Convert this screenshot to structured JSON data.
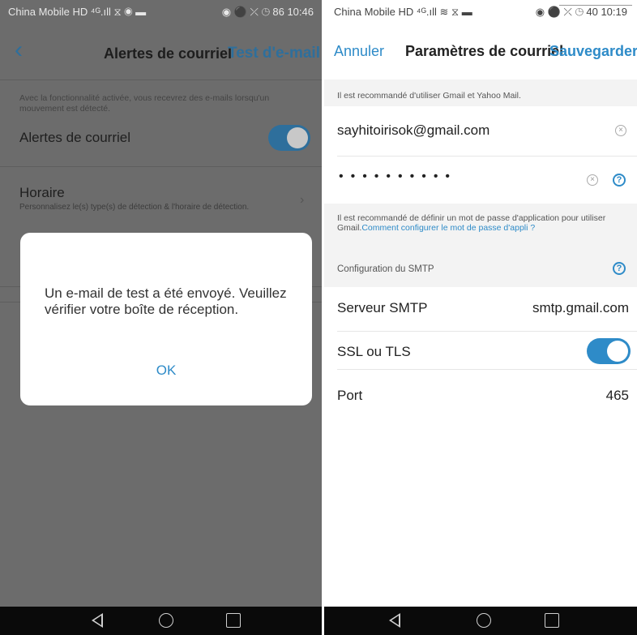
{
  "left": {
    "status_bar": {
      "carrier": "China Mobile",
      "icons": "HD ⁴ᴳ.ıll ⧖ ◉ ▬",
      "right_icons": "◉ ⚫ ⤫ ◷ 86",
      "time": "10:46"
    },
    "nav": {
      "back_icon": "chevron-left-icon",
      "title": "Alertes de courriel",
      "action": "Test d'e-mail"
    },
    "description": "Avec la fonctionnalité activée, vous recevrez des e-mails lorsqu'un mouvement est détecté.",
    "email_alerts": {
      "label": "Alertes de courriel",
      "enabled": true
    },
    "schedule": {
      "label": "Horaire",
      "subtitle": "Personnalisez le(s) type(s) de détection & l'horaire de détection."
    },
    "dialog": {
      "message": "Un e-mail de test a été envoyé. Veuillez vérifier votre boîte de réception.",
      "ok": "OK"
    },
    "colors": {
      "accent": "#2e6f9c",
      "overlay": "#6c6c6c",
      "dialog_button": "#2e8bc8"
    }
  },
  "right": {
    "status_bar": {
      "carrier": "China Mobile",
      "icons": "HD ⁴ᴳ.ıll ≋ ⧖ ▬",
      "right_icons": "◉ ⚫ ⤫ ◷ 40",
      "time": "10:19"
    },
    "nav": {
      "cancel": "Annuler",
      "title": "Paramètres de courriel",
      "save": "Sauvegarder"
    },
    "hint_recommended": "Il est recommandé d'utiliser Gmail et Yahoo Mail.",
    "email_value": "sayhitoirisok@gmail.com",
    "password_mask": "••••••••••",
    "hint_app_password": "Il est recommandé de définir un mot de passe d'application pour utiliser Gmail.",
    "hint_link": "Comment configurer le mot de passe d'appli ?",
    "smtp_section": "Configuration du SMTP",
    "smtp_server": {
      "label": "Serveur SMTP",
      "value": "smtp.gmail.com"
    },
    "ssl_tls": {
      "label": "SSL ou TLS",
      "enabled": true
    },
    "port": {
      "label": "Port",
      "value": "465"
    },
    "colors": {
      "accent": "#2e8bc8",
      "section_bg": "#f3f3f3"
    }
  },
  "system_nav": {
    "back_icon": "triangle-back-icon",
    "home_icon": "circle-home-icon",
    "recent_icon": "square-recent-icon"
  }
}
